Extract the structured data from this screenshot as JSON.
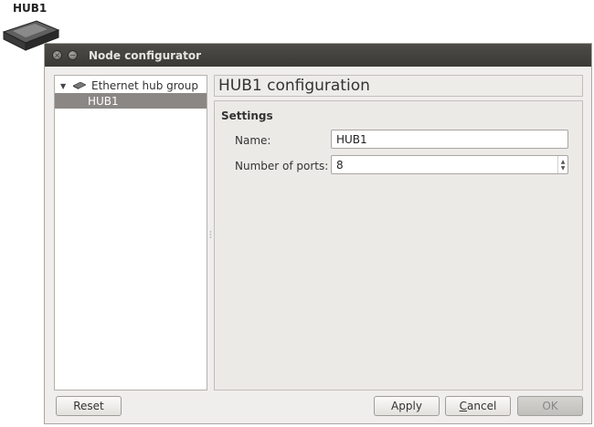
{
  "desktop": {
    "hub_label": "HUB1",
    "hub_icon": "ethernet-hub-icon"
  },
  "window": {
    "title": "Node configurator",
    "controls": [
      "close-icon",
      "minimize-icon"
    ]
  },
  "tree": {
    "group_label": "Ethernet hub group",
    "group_icon": "ethernet-hub-icon",
    "expanded_icon": "triangle-down-icon",
    "items": [
      {
        "label": "HUB1",
        "selected": true
      }
    ]
  },
  "config": {
    "header": "HUB1 configuration",
    "settings_title": "Settings",
    "name_label": "Name:",
    "name_value": "HUB1",
    "ports_label": "Number of ports:",
    "ports_value": "8"
  },
  "buttons": {
    "reset": "Reset",
    "apply": "Apply",
    "cancel_prefix": "",
    "cancel_mnemonic": "C",
    "cancel_rest": "ancel",
    "ok": "OK"
  },
  "colors": {
    "titlebar": "#3a3935",
    "selection": "#8a8784",
    "dialog_bg": "#f0eeec"
  }
}
